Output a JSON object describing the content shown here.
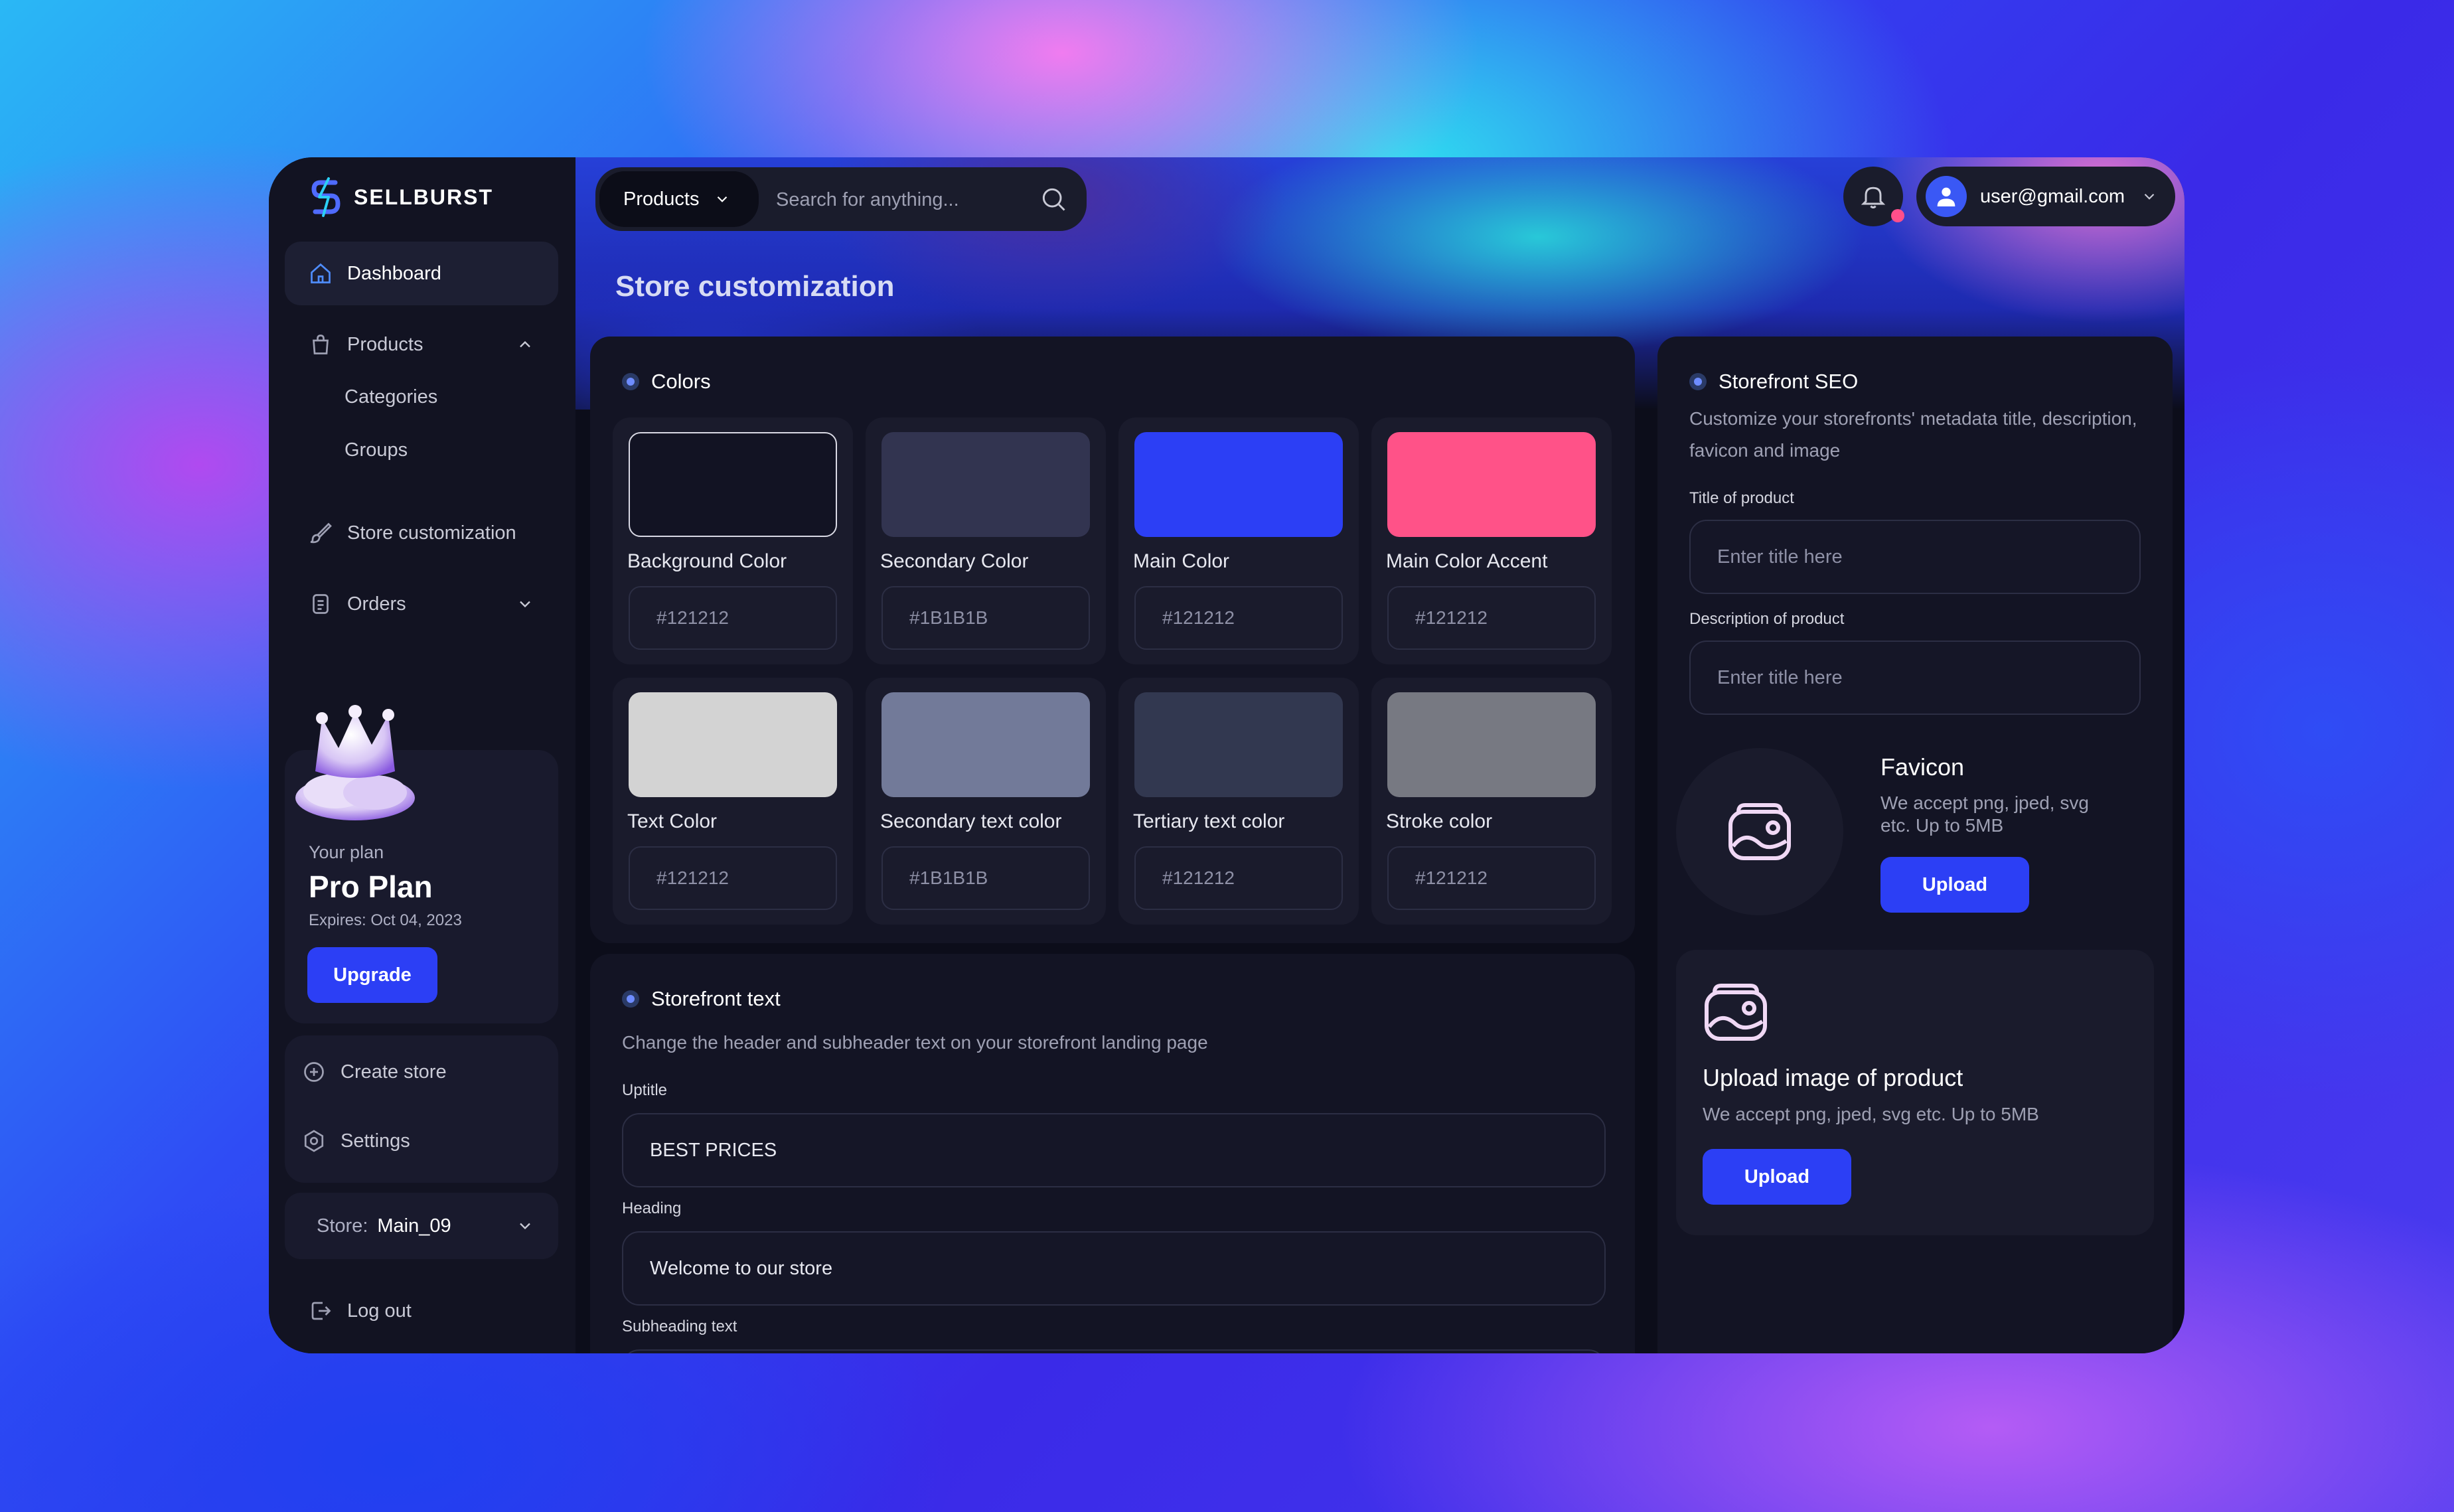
{
  "brand": {
    "name": "SELLBURST"
  },
  "sidebar": {
    "dashboard": "Dashboard",
    "products": "Products",
    "categories": "Categories",
    "groups": "Groups",
    "store_customization": "Store customization",
    "orders": "Orders",
    "plan": {
      "label": "Your plan",
      "name": "Pro Plan",
      "expires": "Expires: Oct 04, 2023",
      "upgrade": "Upgrade"
    },
    "create_store": "Create store",
    "settings": "Settings",
    "store_label": "Store:",
    "store_value": "Main_09",
    "logout": "Log out"
  },
  "topbar": {
    "category": "Products",
    "search_placeholder": "Search for anything...",
    "user_email": "user@gmail.com"
  },
  "page": {
    "title": "Store customization"
  },
  "colors": {
    "heading": "Colors",
    "swatches": [
      {
        "name": "Background Color",
        "hex": "#121212",
        "fill": "#121323"
      },
      {
        "name": "Secondary Color",
        "hex": "#1B1B1B",
        "fill": "#323450"
      },
      {
        "name": "Main Color",
        "hex": "#121212",
        "fill": "#2c3ff5"
      },
      {
        "name": "Main Color Accent",
        "hex": "#121212",
        "fill": "#ff5288"
      },
      {
        "name": "Text Color",
        "hex": "#121212",
        "fill": "#d3d3d3"
      },
      {
        "name": "Secondary text color",
        "hex": "#1B1B1B",
        "fill": "#727a99"
      },
      {
        "name": "Tertiary text color",
        "hex": "#121212",
        "fill": "#323850"
      },
      {
        "name": "Stroke  color",
        "hex": "#121212",
        "fill": "#777982"
      }
    ]
  },
  "storefront_text": {
    "heading": "Storefront text",
    "description": "Change the header and subheader text on your storefront landing page",
    "uptitle_label": "Uptitle",
    "uptitle_value": "BEST PRICES",
    "heading_label": "Heading",
    "heading_value": "Welcome to our store",
    "subheading_label": "Subheading text"
  },
  "seo": {
    "heading": "Storefront SEO",
    "description": "Customize your storefronts' metadata title, description, favicon and image",
    "title_label": "Title of product",
    "title_placeholder": "Enter title here",
    "desc_label": "Description of product",
    "desc_placeholder": "Enter title here",
    "favicon_title": "Favicon",
    "favicon_desc": "We accept png, jped, svg etc. Up to 5MB",
    "favicon_upload": "Upload",
    "image_title": "Upload image of product",
    "image_desc": "We accept png, jped, svg etc. Up to 5MB",
    "image_upload": "Upload"
  }
}
